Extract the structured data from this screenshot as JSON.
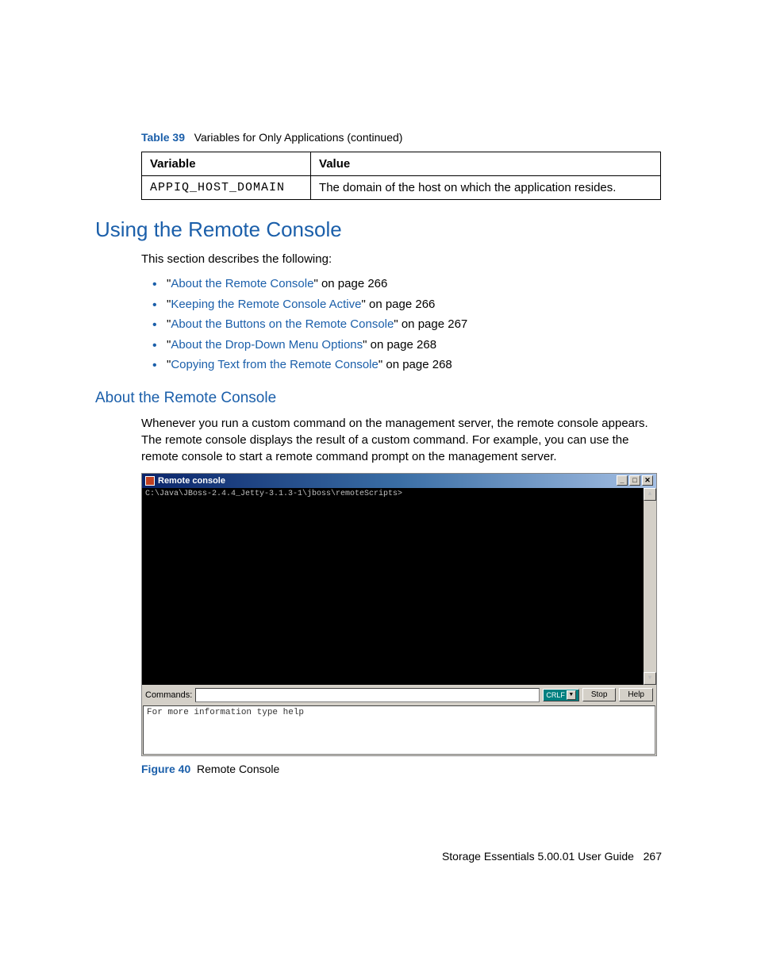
{
  "tableCaption": {
    "label": "Table 39",
    "text": "Variables for Only Applications (continued)"
  },
  "table": {
    "headers": {
      "c1": "Variable",
      "c2": "Value"
    },
    "row": {
      "c1": "APPIQ_HOST_DOMAIN",
      "c2": "The domain of the host on which the application resides."
    }
  },
  "h1": "Using the Remote Console",
  "intro": "This section describes the following:",
  "links": [
    {
      "title": "About the Remote Console",
      "suffix": "\" on page 266"
    },
    {
      "title": "Keeping the Remote Console Active",
      "suffix": "\" on page 266"
    },
    {
      "title": "About the Buttons on the Remote Console",
      "suffix": "\" on page 267"
    },
    {
      "title": "About the Drop-Down Menu Options",
      "suffix": "\" on page 268"
    },
    {
      "title": "Copying Text from the Remote Console",
      "suffix": "\" on page 268"
    }
  ],
  "h2": "About the Remote Console",
  "para": "Whenever you run a custom command on the management server, the remote console appears. The remote console displays the result of a custom command. For example, you can use the remote console to start a remote command prompt on the management server.",
  "console": {
    "title": "Remote console",
    "prompt": "C:\\Java\\JBoss-2.4.4_Jetty-3.1.3-1\\jboss\\remoteScripts>",
    "commandsLabel": "Commands:",
    "crlf": "CRLF",
    "stop": "Stop",
    "help": "Help",
    "outputHint": "For more information type help",
    "winMin": "_",
    "winMax": "□",
    "winClose": "✕",
    "arrowUp": "▲",
    "arrowDn": "▼"
  },
  "figCaption": {
    "label": "Figure 40",
    "text": "Remote Console"
  },
  "footer": {
    "text": "Storage Essentials 5.00.01 User Guide",
    "page": "267"
  }
}
